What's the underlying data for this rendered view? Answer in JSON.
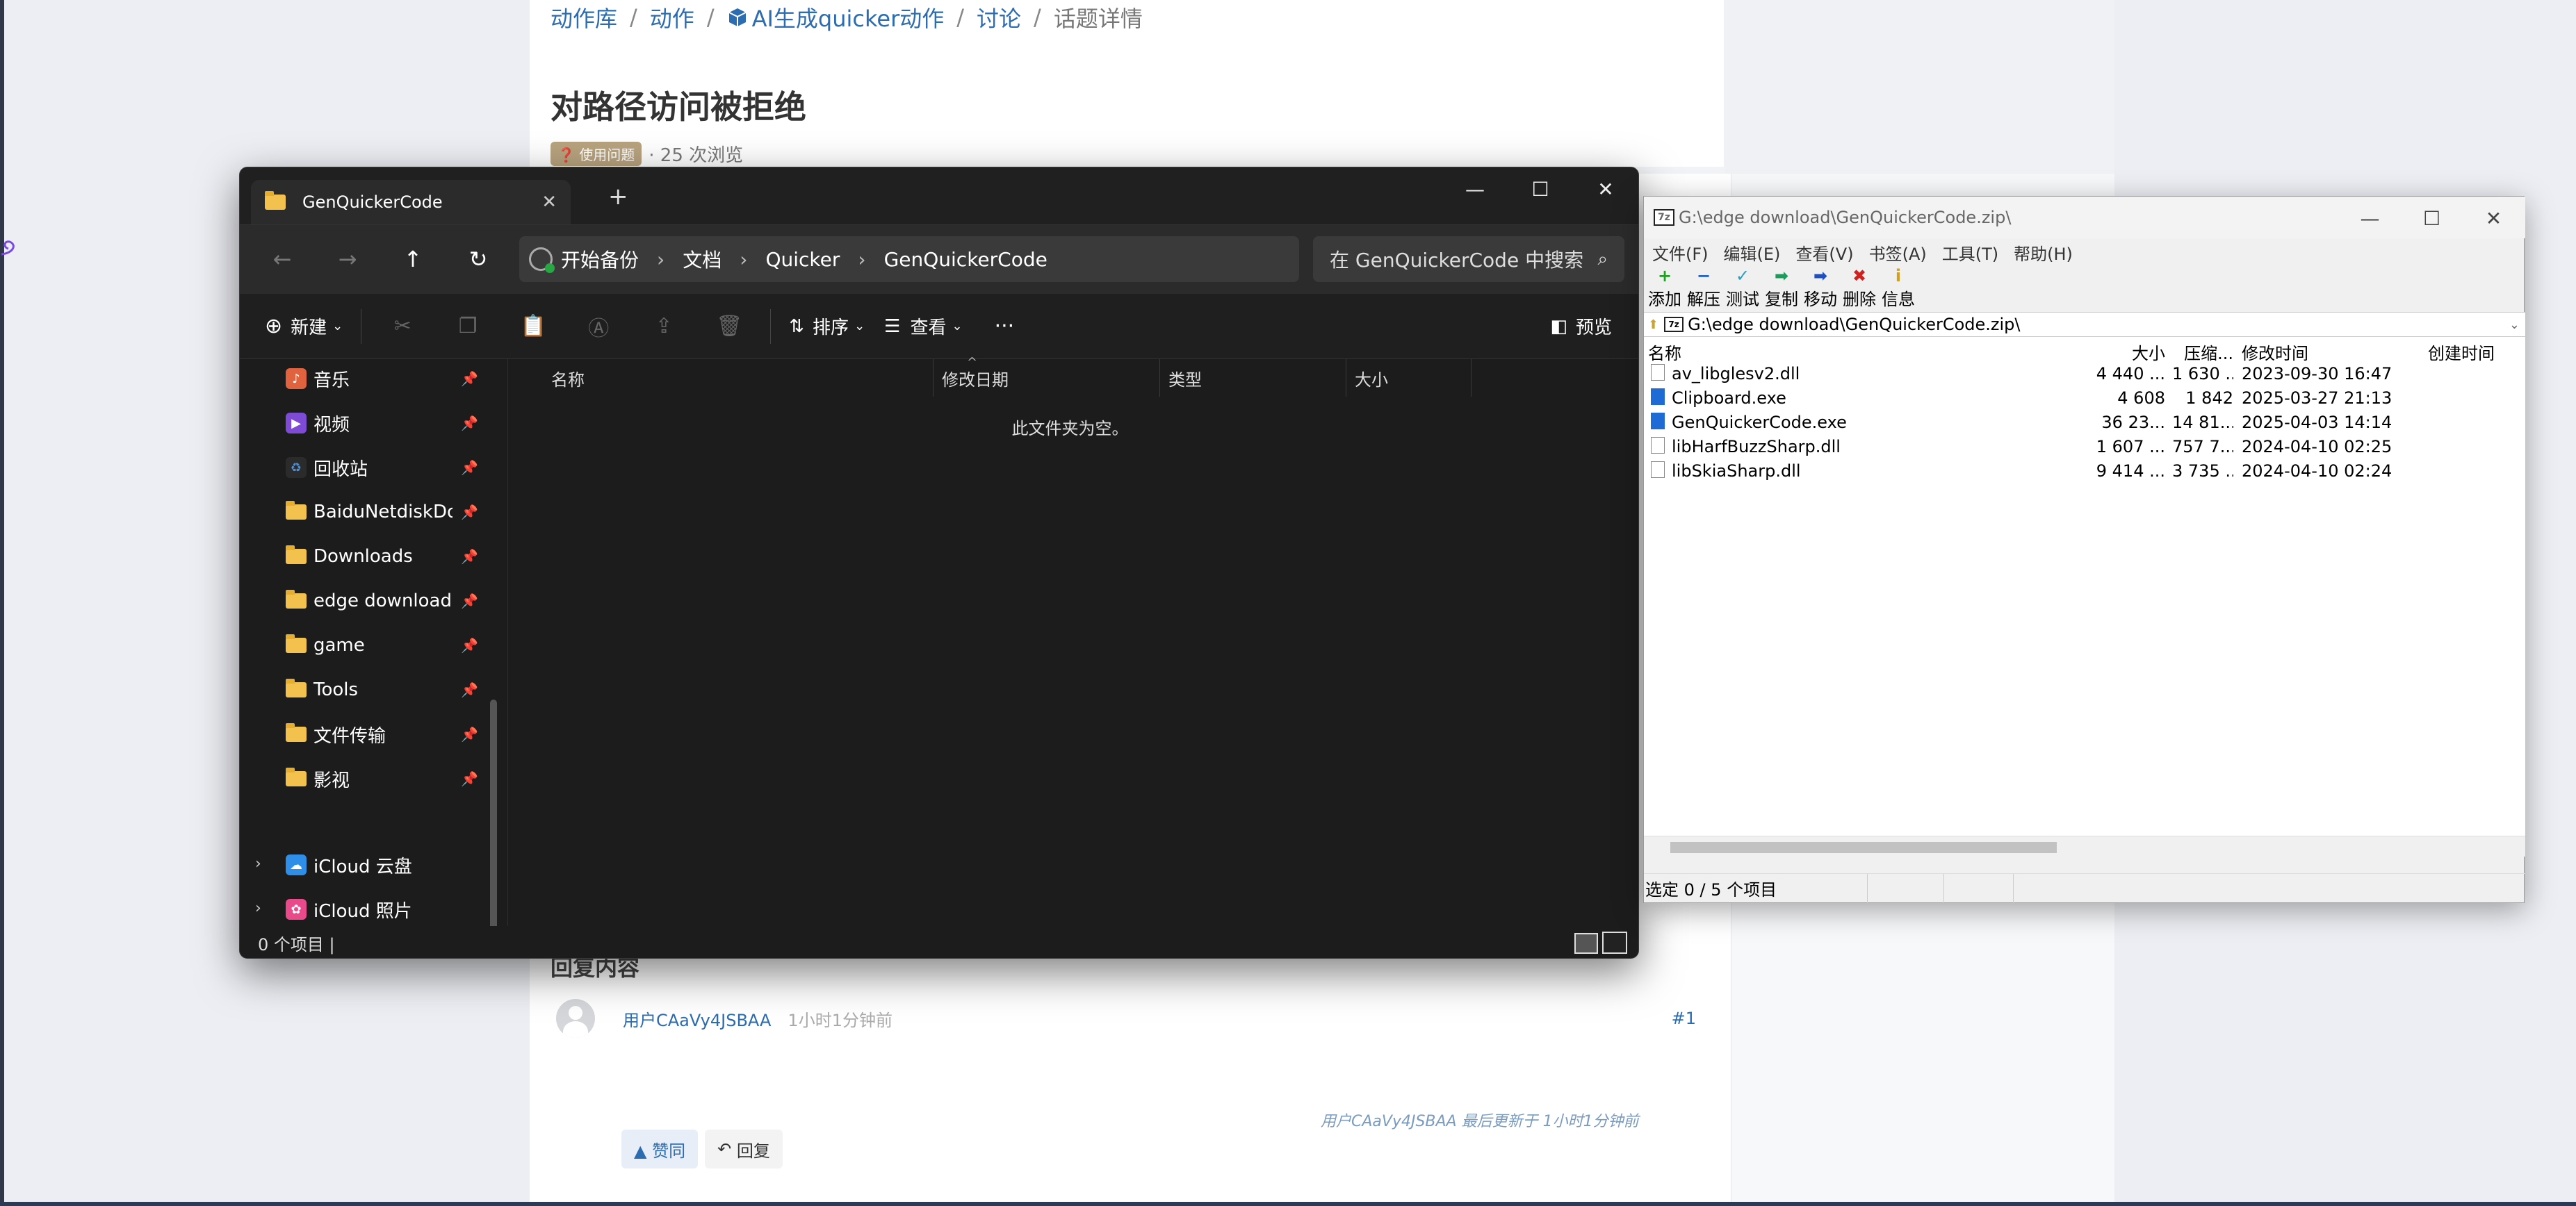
{
  "web": {
    "breadcrumb": [
      "动作库",
      "动作",
      "AI生成quicker动作",
      "讨论",
      "话题详情"
    ],
    "title": "对路径访问被拒绝",
    "tag": "❓ 使用问题",
    "views": "· 25 次浏览",
    "reply_heading": "回复内容",
    "reply": {
      "user": "用户CAaVy4JSBAA",
      "time": "1小时1分钟前",
      "index": "#1",
      "edited": "用户CAaVy4JSBAA 最后更新于 1小时1分钟前",
      "like": "▲ 赞同",
      "reply": "回复"
    }
  },
  "explorer": {
    "tab_title": "GenQuickerCode",
    "address": [
      "开始备份",
      "文档",
      "Quicker",
      "GenQuickerCode"
    ],
    "search_placeholder": "在 GenQuickerCode 中搜索",
    "cmd": {
      "new": "新建",
      "sort": "排序",
      "view": "查看",
      "more": "···",
      "preview": "预览"
    },
    "sidebar": [
      {
        "label": "音乐",
        "icon": "music-icon",
        "color": "#e0623f"
      },
      {
        "label": "视频",
        "icon": "video-icon",
        "color": "#7d4bd6"
      },
      {
        "label": "回收站",
        "icon": "recycle-bin-icon",
        "color": "#4a90d9"
      },
      {
        "label": "BaiduNetdiskDownload",
        "icon": "folder-icon"
      },
      {
        "label": "Downloads",
        "icon": "folder-icon"
      },
      {
        "label": "edge download",
        "icon": "folder-icon"
      },
      {
        "label": "game",
        "icon": "folder-icon"
      },
      {
        "label": "Tools",
        "icon": "folder-icon"
      },
      {
        "label": "文件传输",
        "icon": "folder-icon"
      },
      {
        "label": "影视",
        "icon": "folder-icon"
      }
    ],
    "cloud": [
      {
        "label": "iCloud 云盘",
        "color": "#2f8fe8"
      },
      {
        "label": "iCloud 照片",
        "color": "#e84a8a"
      }
    ],
    "columns": [
      "名称",
      "修改日期",
      "类型",
      "大小"
    ],
    "empty_text": "此文件夹为空。",
    "status": "0 个项目  |"
  },
  "sevenzip": {
    "title": "G:\\edge download\\GenQuickerCode.zip\\",
    "menu": [
      "文件(F)",
      "编辑(E)",
      "查看(V)",
      "书签(A)",
      "工具(T)",
      "帮助(H)"
    ],
    "toolbar": [
      {
        "label": "添加",
        "glyph": "+",
        "color": "#22a022"
      },
      {
        "label": "解压",
        "glyph": "−",
        "color": "#2060d0"
      },
      {
        "label": "测试",
        "glyph": "✓",
        "color": "#2aa0c0"
      },
      {
        "label": "复制",
        "glyph": "➡",
        "color": "#1c9c5c"
      },
      {
        "label": "移动",
        "glyph": "➡",
        "color": "#2050c0"
      },
      {
        "label": "删除",
        "glyph": "✖",
        "color": "#d02020"
      },
      {
        "label": "信息",
        "glyph": "i",
        "color": "#d0a020"
      }
    ],
    "address": "G:\\edge download\\GenQuickerCode.zip\\",
    "columns": [
      "名称",
      "大小",
      "压缩...",
      "修改时间",
      "创建时间"
    ],
    "files": [
      {
        "name": "av_libglesv2.dll",
        "size": "4 440 ...",
        "packed": "1 630 ...",
        "modified": "2023-09-30 16:47",
        "type": "dll"
      },
      {
        "name": "Clipboard.exe",
        "size": "4 608",
        "packed": "1 842",
        "modified": "2025-03-27 21:13",
        "type": "exe"
      },
      {
        "name": "GenQuickerCode.exe",
        "size": "36 23...",
        "packed": "14 81...",
        "modified": "2025-04-03 14:14",
        "type": "exe"
      },
      {
        "name": "libHarfBuzzSharp.dll",
        "size": "1 607 ...",
        "packed": "757 7...",
        "modified": "2024-04-10 02:25",
        "type": "dll"
      },
      {
        "name": "libSkiaSharp.dll",
        "size": "9 414 ...",
        "packed": "3 735 ...",
        "modified": "2024-04-10 02:24",
        "type": "dll"
      }
    ],
    "status": "选定 0 / 5 个项目"
  }
}
